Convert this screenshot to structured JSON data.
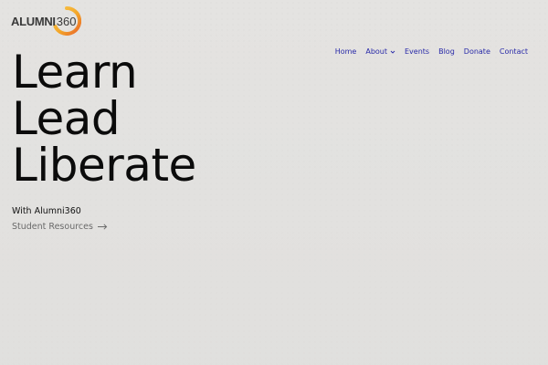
{
  "brand": {
    "name": "ALUMNI",
    "number": "360",
    "ring_colors": [
      "#f3a629",
      "#e9672a"
    ]
  },
  "nav": {
    "items": [
      {
        "label": "Home",
        "has_dropdown": false
      },
      {
        "label": "About",
        "has_dropdown": true
      },
      {
        "label": "Events",
        "has_dropdown": false
      },
      {
        "label": "Blog",
        "has_dropdown": false
      },
      {
        "label": "Donate",
        "has_dropdown": false
      },
      {
        "label": "Contact",
        "has_dropdown": false
      }
    ],
    "link_color": "#2a2aa8"
  },
  "hero": {
    "lines": [
      "Learn",
      "Lead",
      "Liberate"
    ],
    "subtitle": "With Alumni360",
    "cta_label": "Student Resources",
    "cta_icon": "arrow-right-icon"
  }
}
